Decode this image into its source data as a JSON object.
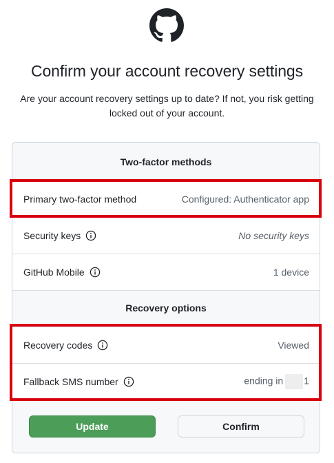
{
  "page": {
    "title": "Confirm your account recovery settings",
    "subtitle": "Are your account recovery settings up to date? If not, you risk getting locked out of your account."
  },
  "two_factor": {
    "heading": "Two-factor methods",
    "rows": [
      {
        "label": "Primary two-factor method",
        "value": "Configured: Authenticator app",
        "has_info": false
      },
      {
        "label": "Security keys",
        "value": "No security keys",
        "has_info": true
      },
      {
        "label": "GitHub Mobile",
        "value": "1 device",
        "has_info": true
      }
    ]
  },
  "recovery": {
    "heading": "Recovery options",
    "rows": [
      {
        "label": "Recovery codes",
        "value": "Viewed",
        "has_info": true
      },
      {
        "label": "Fallback SMS number",
        "value_prefix": "ending in",
        "value_suffix": "1",
        "has_info": true
      }
    ]
  },
  "actions": {
    "update_label": "Update",
    "confirm_label": "Confirm"
  },
  "colors": {
    "highlight": "#d9000d",
    "update_button": "#4c9d58",
    "border": "#d0d7de"
  },
  "icons": {
    "logo": "github-octocat-icon",
    "info": "info-circle-icon"
  }
}
